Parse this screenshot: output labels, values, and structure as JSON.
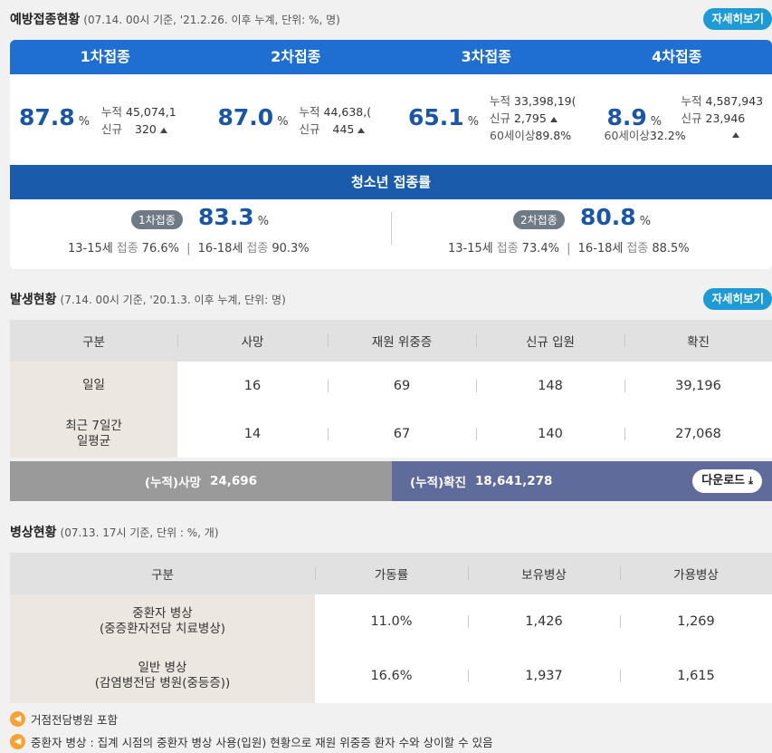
{
  "vaccination": {
    "title": "예방접종현황",
    "note": "(07.14. 00시 기준, '21.2.26. 이후 누계, 단위: %, 명)",
    "detail_label": "자세히보기",
    "doses": [
      {
        "tab": "1차접종",
        "pct": "87.8",
        "unit": "%",
        "cum_label": "누적",
        "cum": "45,074,1",
        "new_label": "신규",
        "new": "320"
      },
      {
        "tab": "2차접종",
        "pct": "87.0",
        "unit": "%",
        "cum_label": "누적",
        "cum": "44,638,(",
        "new_label": "신규",
        "new": "445"
      },
      {
        "tab": "3차접종",
        "pct": "65.1",
        "unit": "%",
        "cum_label": "누적",
        "cum": "33,398,19(",
        "new_label": "신규",
        "new": "2,795",
        "age_label": "60세이상",
        "age_pct": "89.8%"
      },
      {
        "tab": "4차접종",
        "pct": "8.9",
        "unit": "%",
        "cum_label": "누적",
        "cum": "4,587,943",
        "new_label": "신규",
        "new": "23,946",
        "age_label": "60세이상",
        "age_pct": "32.2%"
      }
    ],
    "teen": {
      "title": "청소년 접종률",
      "halves": [
        {
          "badge": "1차접종",
          "pct": "83.3",
          "unit": "%",
          "a_age": "13-15세",
          "a_label": "접종",
          "a_val": "76.6%",
          "b_age": "16-18세",
          "b_label": "접종",
          "b_val": "90.3%"
        },
        {
          "badge": "2차접종",
          "pct": "80.8",
          "unit": "%",
          "a_age": "13-15세",
          "a_label": "접종",
          "a_val": "73.4%",
          "b_age": "16-18세",
          "b_label": "접종",
          "b_val": "88.5%"
        }
      ]
    }
  },
  "occurrence": {
    "title": "발생현황",
    "note": "(7.14. 00시 기준, '20.1.3. 이후 누계, 단위: 명)",
    "detail_label": "자세히보기",
    "headers": [
      "구분",
      "사망",
      "재원 위중증",
      "신규 입원",
      "확진"
    ],
    "rows": [
      {
        "label": "일일",
        "values": [
          "16",
          "69",
          "148",
          "39,196"
        ]
      },
      {
        "label": "최근 7일간\n일평균",
        "values": [
          "14",
          "67",
          "140",
          "27,068"
        ]
      }
    ],
    "cum_death_label": "(누적)사망",
    "cum_death": "24,696",
    "cum_conf_label": "(누적)확진",
    "cum_conf": "18,641,278",
    "download_label": "다운로드"
  },
  "beds": {
    "title": "병상현황",
    "note": "(07.13. 17시 기준, 단위 : %, 개)",
    "headers": [
      "구분",
      "가동률",
      "보유병상",
      "가용병상"
    ],
    "rows": [
      {
        "label1": "중환자 병상",
        "label2": "(중증환자전담 치료병상)",
        "values": [
          "11.0%",
          "1,426",
          "1,269"
        ]
      },
      {
        "label1": "일반 병상",
        "label2": "(감염병전담 병원(중등증))",
        "values": [
          "16.6%",
          "1,937",
          "1,615"
        ]
      }
    ]
  },
  "footnotes": [
    "거점전담병원 포함",
    "중환자 병상 : 집계 시점의 중환자 병상 사용(입원) 현황으로 재원 위중증 환자 수와 상이할 수 있음"
  ]
}
